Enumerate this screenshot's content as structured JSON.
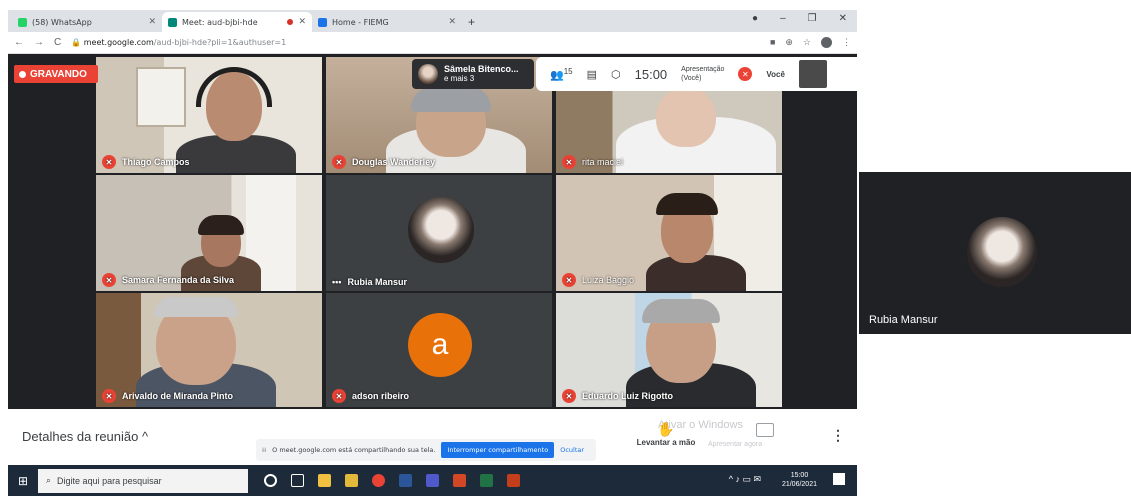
{
  "browser": {
    "tabs": [
      {
        "label": "(58) WhatsApp",
        "icon_color": "#25d366"
      },
      {
        "label": "Meet: aud-bjbi-hde",
        "icon_color": "#00897b",
        "recording": true
      },
      {
        "label": "Home - FIEMG",
        "icon_color": "#1a73e8"
      }
    ],
    "new_tab": "+",
    "url": "meet.google.com",
    "url_path": "/aud-bjbi-hde?pli=1&authuser=1"
  },
  "meet": {
    "recording_label": "GRAVANDO",
    "presenting": {
      "name": "Sâmela Bitenco...",
      "more": "e mais 3"
    },
    "participant_count": "15",
    "clock": "15:00",
    "presentation_label": "Apresentação",
    "presentation_sub": "(Você)",
    "you_label": "Você",
    "tiles": [
      {
        "name": "Thiago Campos",
        "muted": true
      },
      {
        "name": "Douglas Wanderley",
        "muted": true
      },
      {
        "name": "rita maciel",
        "muted": true
      },
      {
        "name": "Samara Fernanda da Silva",
        "muted": true
      },
      {
        "name": "Rubia Mansur",
        "muted": false
      },
      {
        "name": "Luiza Baggio",
        "muted": true
      },
      {
        "name": "Arivaldo de Miranda Pinto",
        "muted": true
      },
      {
        "name": "adson ribeiro",
        "muted": true,
        "initial": "a"
      },
      {
        "name": "Eduardo Luiz Rigotto",
        "muted": true
      }
    ]
  },
  "bottom": {
    "details_label": "Detalhes da reunião",
    "share_message": "O meet.google.com está compartilhando sua tela.",
    "stop_share_label": "Interromper compartilhamento",
    "hide_label": "Ocultar",
    "raise_hand_label": "Levantar a mão",
    "present_label": "Apresentar agora",
    "watermark": "Ativar o Windows"
  },
  "taskbar": {
    "search_placeholder": "Digite aqui para pesquisar",
    "time": "15:00",
    "date": "21/06/2021"
  },
  "side_window": {
    "name": "Rubia Mansur"
  }
}
